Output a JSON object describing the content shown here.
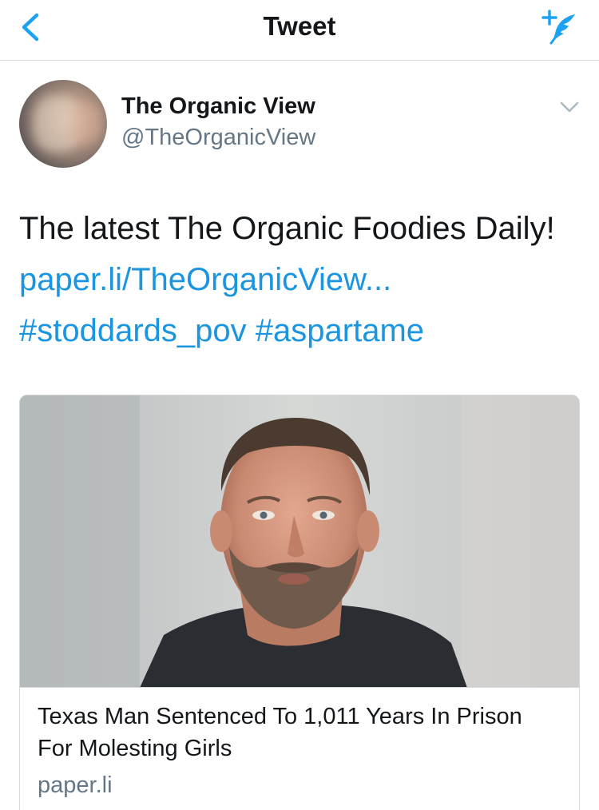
{
  "nav": {
    "title": "Tweet",
    "back_icon": "chevron-left-icon",
    "compose_icon": "compose-tweet-icon",
    "accent_color": "#1da1f2"
  },
  "tweet": {
    "author_name": "The Organic View",
    "author_handle": "@TheOrganicView",
    "text_plain": "The latest The Organic Foodies Daily!",
    "link_text": "paper.li/TheOrganicView...",
    "hashtags": [
      "#stoddards_pov",
      "#aspartame"
    ],
    "menu_icon": "chevron-down-icon"
  },
  "card": {
    "title": "Texas Man Sentenced To 1,011 Years In Prison For Molesting Girls",
    "domain": "paper.li"
  },
  "colors": {
    "link": "#1b95e0",
    "secondary_text": "#657786",
    "primary_text": "#14171a",
    "border": "#d5d9dd"
  }
}
